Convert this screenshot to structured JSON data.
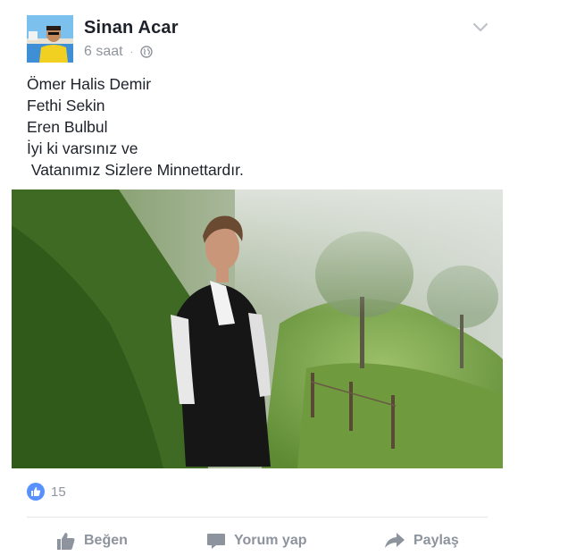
{
  "post": {
    "author": "Sinan Acar",
    "timestamp": "6 saat",
    "privacy_icon": "globe-icon",
    "menu_icon": "chevron-down-icon",
    "text_lines": [
      "Ömer Halis Demir",
      "Fethi Sekin",
      "Eren Bulbul",
      "İyi ki varsınız ve",
      " Vatanımız Sizlere Minnettardır."
    ]
  },
  "reactions": {
    "icon": "thumbs-up-icon",
    "count": "15"
  },
  "actions": {
    "like_label": "Beğen",
    "comment_label": "Yorum yap",
    "share_label": "Paylaş"
  },
  "colors": {
    "author_text": "#1d2129",
    "meta_text": "#90949c",
    "like_badge": "#5890ff",
    "action_text": "#8d949e",
    "divider": "#e5e5e5"
  }
}
